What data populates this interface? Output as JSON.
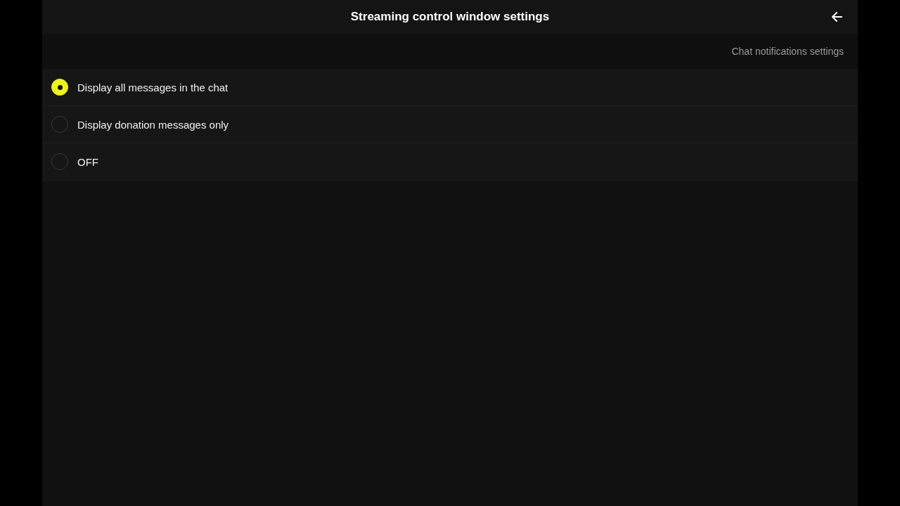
{
  "header": {
    "title": "Streaming control window settings"
  },
  "section": {
    "title": "Chat notifications settings"
  },
  "options": [
    {
      "label": "Display all messages in the chat",
      "selected": true
    },
    {
      "label": "Display donation messages only",
      "selected": false
    },
    {
      "label": "OFF",
      "selected": false
    }
  ]
}
